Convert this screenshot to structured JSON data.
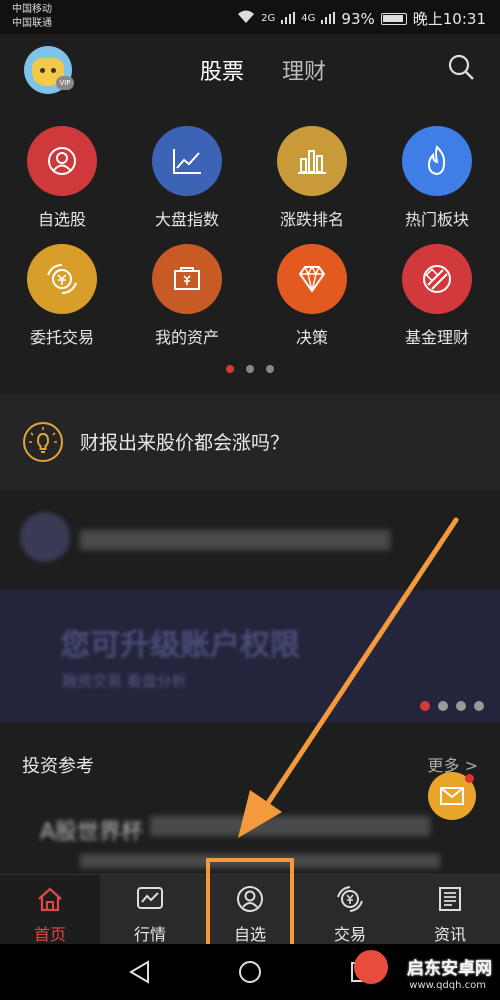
{
  "status": {
    "carrier1": "中国移动",
    "carrier2": "中国联通",
    "net1": "2G",
    "net2": "4G",
    "battery": "93%",
    "time": "晚上10:31"
  },
  "header": {
    "tabs": [
      "股票",
      "理财"
    ],
    "vip": "VIP"
  },
  "grid": {
    "items": [
      {
        "label": "自选股",
        "icon": "user-circle-icon",
        "color": "#d0393b"
      },
      {
        "label": "大盘指数",
        "icon": "line-chart-icon",
        "color": "#3c63b5"
      },
      {
        "label": "涨跌排名",
        "icon": "bar-chart-icon",
        "color": "#c99a3a"
      },
      {
        "label": "热门板块",
        "icon": "flame-icon",
        "color": "#3e7ee6"
      },
      {
        "label": "委托交易",
        "icon": "yuan-exchange-icon",
        "color": "#d99d2a"
      },
      {
        "label": "我的资产",
        "icon": "wallet-icon",
        "color": "#c85a26"
      },
      {
        "label": "决策",
        "icon": "diamond-icon",
        "color": "#e25a1f"
      },
      {
        "label": "基金理财",
        "icon": "fund-icon",
        "color": "#d2393c"
      }
    ]
  },
  "tip": {
    "text": "财报出来股价都会涨吗？"
  },
  "banner": {
    "text": "您可升级账户权限",
    "sub": "融资交易 看盘分析"
  },
  "reference": {
    "title": "投资参考",
    "more": "更多 >",
    "item_title": "A股世界杯"
  },
  "nav": {
    "items": [
      {
        "label": "首页",
        "icon": "home-icon"
      },
      {
        "label": "行情",
        "icon": "chart-icon"
      },
      {
        "label": "自选",
        "icon": "user-circle-icon"
      },
      {
        "label": "交易",
        "icon": "yuan-exchange-icon"
      },
      {
        "label": "资讯",
        "icon": "news-icon"
      }
    ]
  },
  "watermark": {
    "title": "启东安卓网",
    "url": "www.qdqh.com"
  },
  "colors": {
    "accent": "#e04848",
    "highlight": "#f39a3c"
  }
}
